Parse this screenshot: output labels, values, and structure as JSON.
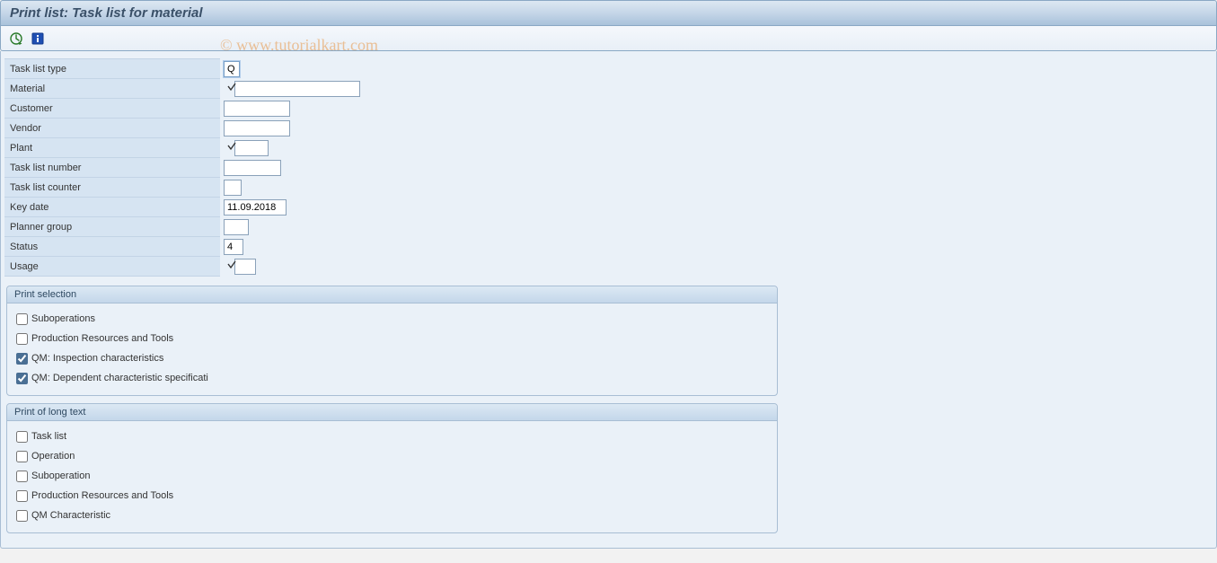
{
  "title": "Print list: Task list for material",
  "watermark": "© www.tutorialkart.com",
  "fields": {
    "task_list_type": {
      "label": "Task list type",
      "value": "Q"
    },
    "material": {
      "label": "Material",
      "value": ""
    },
    "customer": {
      "label": "Customer",
      "value": ""
    },
    "vendor": {
      "label": "Vendor",
      "value": ""
    },
    "plant": {
      "label": "Plant",
      "value": ""
    },
    "task_list_number": {
      "label": "Task list number",
      "value": ""
    },
    "task_list_counter": {
      "label": "Task list counter",
      "value": ""
    },
    "key_date": {
      "label": "Key date",
      "value": "11.09.2018"
    },
    "planner_group": {
      "label": "Planner group",
      "value": ""
    },
    "status": {
      "label": "Status",
      "value": "4"
    },
    "usage": {
      "label": "Usage",
      "value": ""
    }
  },
  "groups": {
    "print_selection": {
      "title": "Print selection",
      "items": [
        {
          "label": "Suboperations",
          "checked": false
        },
        {
          "label": "Production Resources and Tools",
          "checked": false
        },
        {
          "label": "QM: Inspection characteristics",
          "checked": true
        },
        {
          "label": "QM: Dependent characteristic specificati",
          "checked": true
        }
      ]
    },
    "print_long_text": {
      "title": "Print of long text",
      "items": [
        {
          "label": "Task list",
          "checked": false
        },
        {
          "label": "Operation",
          "checked": false
        },
        {
          "label": "Suboperation",
          "checked": false
        },
        {
          "label": "Production Resources and Tools",
          "checked": false
        },
        {
          "label": "QM Characteristic",
          "checked": false
        }
      ]
    }
  }
}
